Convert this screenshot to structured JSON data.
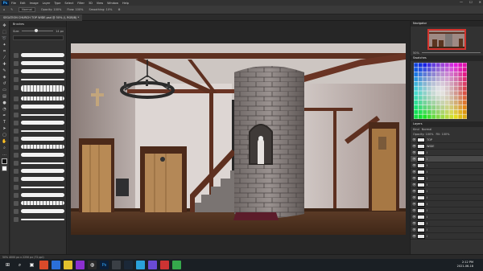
{
  "app": {
    "logo": "Ps",
    "menu": [
      "File",
      "Edit",
      "Image",
      "Layer",
      "Type",
      "Select",
      "Filter",
      "3D",
      "View",
      "Window",
      "Help"
    ],
    "window_controls": [
      "—",
      "☐",
      "✕"
    ]
  },
  "options_bar": {
    "mode": "Normal",
    "opacity": "Opacity: 100%",
    "flow": "Flow: 100%",
    "smoothing": "Smoothing: 10%"
  },
  "document": {
    "tab_title": "SEGATION CHURCH TOP WIDE.psd @ 50% (l, RGB/8) *",
    "status": "50%   4000 px x 2250 px (72 ppi)"
  },
  "panels": {
    "brushes_title": "Brushes",
    "brush_size_label": "Size:",
    "brush_size_value": "14 px",
    "navigator_title": "Navigator",
    "navigator_zoom": "50%",
    "swatches_title": "Swatches",
    "layers_title": "Layers",
    "layers_kind": "Kind",
    "layers_blend": "Normal",
    "layers_opacity": "Opacity: 100%",
    "layers_fill": "Fill: 100%",
    "layer_names": [
      "TOP",
      "WIDE",
      "l",
      "l",
      "l",
      "l",
      "l",
      "l",
      "l",
      "l",
      "l",
      "l",
      "l",
      "l",
      "l",
      "l"
    ]
  },
  "taskbar": {
    "time": "2:12 PM",
    "date": "2021-06-18"
  },
  "icons": {
    "toolbar": [
      "move-icon",
      "marquee-icon",
      "lasso-icon",
      "quick-select-icon",
      "crop-icon",
      "eyedropper-icon",
      "healing-icon",
      "brush-icon",
      "clone-icon",
      "history-brush-icon",
      "eraser-icon",
      "gradient-icon",
      "blur-icon",
      "dodge-icon",
      "pen-icon",
      "type-icon",
      "path-select-icon",
      "shape-icon",
      "hand-icon",
      "zoom-icon"
    ]
  },
  "colors": {
    "accent": "#31a8ff",
    "navigator_frame": "#d2342e"
  }
}
